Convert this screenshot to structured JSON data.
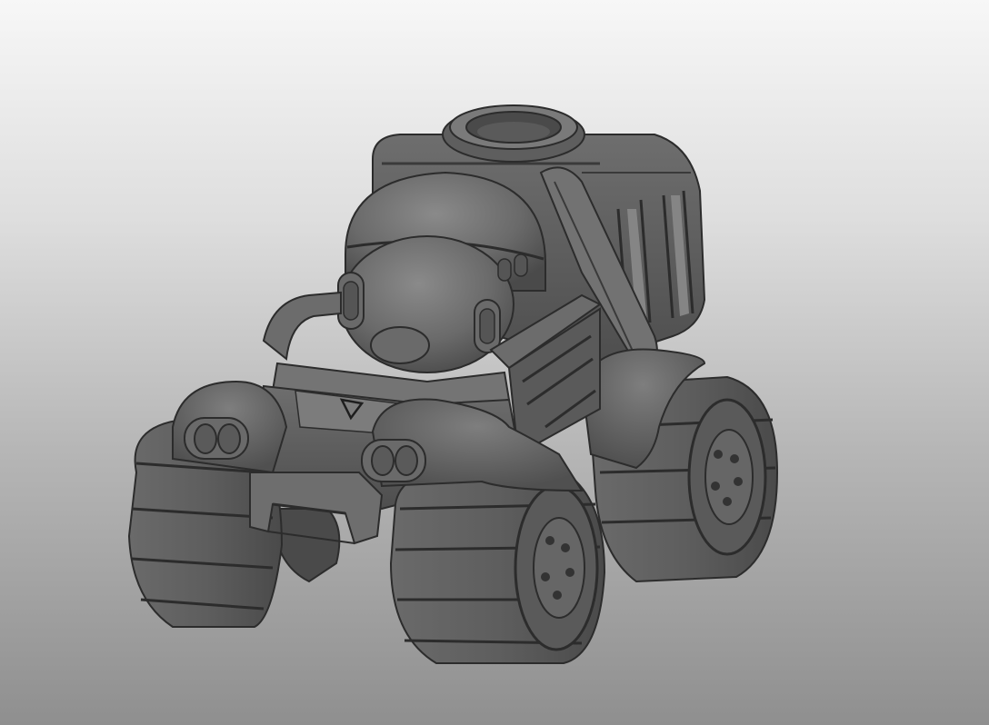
{
  "viewport": {
    "background_top": "#f7f7f7",
    "background_bottom": "#8f8f8f"
  },
  "model": {
    "icon": "rover-vehicle-model",
    "shade_dark": "#2c2c2c",
    "shade_mid": "#5a5a5a",
    "shade_light": "#7a7a7a",
    "shade_highlight": "#8c8c8c"
  }
}
